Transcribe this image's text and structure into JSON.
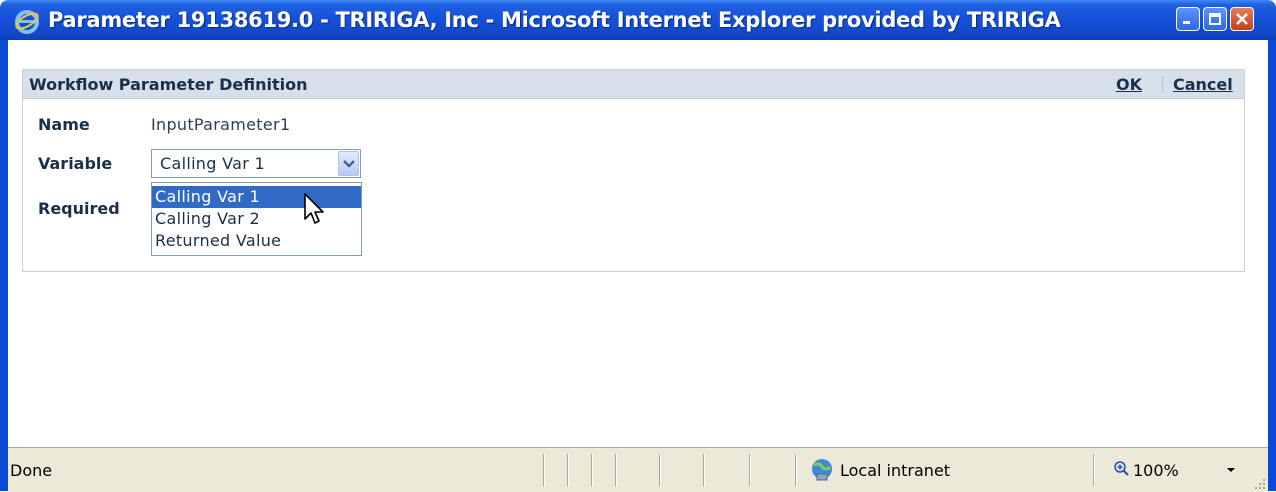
{
  "window": {
    "title": "Parameter 19138619.0 - TRIRIGA, Inc - Microsoft Internet Explorer provided by TRIRIGA",
    "icon": "ie-icon",
    "controls": [
      "minimize-icon",
      "maximize-icon",
      "close-icon"
    ]
  },
  "panel": {
    "title": "Workflow Parameter Definition",
    "ok_label": "OK",
    "cancel_label": "Cancel"
  },
  "form": {
    "name_label": "Name",
    "name_value": "InputParameter1",
    "variable_label": "Variable",
    "variable_selected": "Calling Var 1",
    "required_label": "Required",
    "variable_options": [
      "Calling Var 1",
      "Calling Var 2",
      "Returned Value"
    ],
    "highlighted_option": "Calling Var 1"
  },
  "statusbar": {
    "status_text": "Done",
    "zone_text": "Local intranet",
    "zoom_text": "100%"
  },
  "colors": {
    "title_bar": "#1550d8",
    "panel_header": "#d7e0ea",
    "selection": "#316ac5",
    "status_bar": "#ece9d8"
  }
}
